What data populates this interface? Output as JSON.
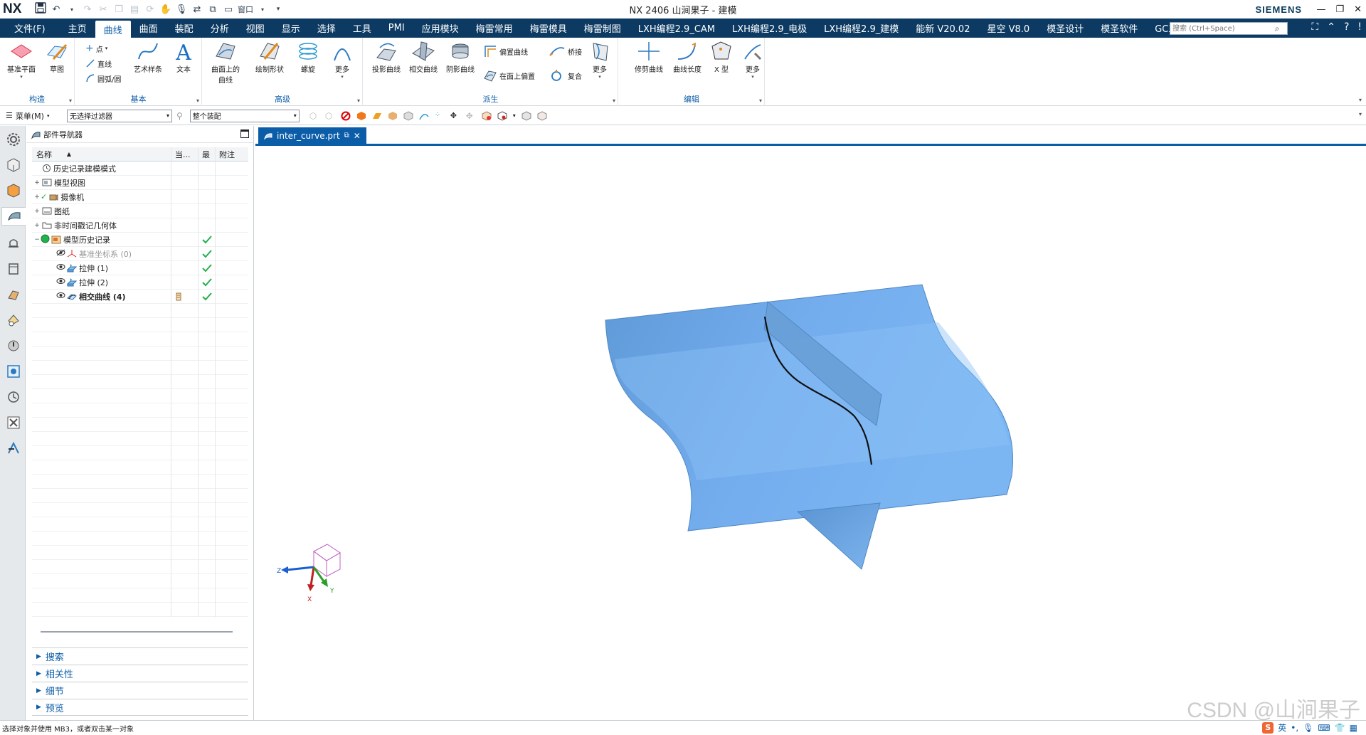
{
  "titlebar": {
    "logo": "NX",
    "window_label": "窗口",
    "title": "NX 2406 山涧果子 - 建模",
    "brand": "SIEMENS",
    "controls": [
      "—",
      "❐",
      "✕"
    ]
  },
  "menu": {
    "tabs": [
      "文件(F)",
      "主页",
      "曲线",
      "曲面",
      "装配",
      "分析",
      "视图",
      "显示",
      "选择",
      "工具",
      "PMI",
      "应用模块",
      "梅雷常用",
      "梅雷模具",
      "梅雷制图",
      "LXH编程2.9_CAM",
      "LXH编程2.9_电极",
      "LXH编程2.9_建模",
      "能新 V20.02",
      "星空 V8.0",
      "模圣设计",
      "模圣软件",
      "GC工具箱"
    ],
    "active_tab": "曲线",
    "search_placeholder": "搜索 (Ctrl+Space)"
  },
  "ribbon": {
    "groups": [
      {
        "label": "构造"
      },
      {
        "label": "基本"
      },
      {
        "label": "高级"
      },
      {
        "label": "派生"
      },
      {
        "label": "编辑"
      }
    ],
    "buttons": {
      "datum_plane": "基准平面",
      "sketch": "草图",
      "point": "点",
      "line": "直线",
      "arc": "圆弧/圆",
      "studio_spline": "艺术样条",
      "text": "文本",
      "curve_on_surface": "曲面上的曲线",
      "law_curve": "绘制形状",
      "helix": "螺旋",
      "more_adv": "更多",
      "project_curve": "投影曲线",
      "intersect_curve": "相交曲线",
      "shadow_curve": "阴影曲线",
      "offset_curve": "偏置曲线",
      "offset_in_face": "在面上偏置",
      "bridge": "桥接",
      "composite": "复合",
      "more_derived": "更多",
      "trim_curve": "修剪曲线",
      "curve_length": "曲线长度",
      "x_form": "X 型",
      "more_edit": "更多"
    }
  },
  "selbar": {
    "menu_label": "菜单(M)",
    "filter_value": "无选择过滤器",
    "scope_value": "整个装配"
  },
  "navigator": {
    "title": "部件导航器",
    "columns": [
      "名称",
      "当...",
      "最",
      "附注"
    ],
    "rows": [
      {
        "label": "历史记录建模模式",
        "expander": "",
        "indent": 0,
        "check": false,
        "style": "normal",
        "icon": "clock-icon",
        "flag": false
      },
      {
        "label": "模型视图",
        "expander": "+",
        "indent": 0,
        "check": false,
        "style": "normal",
        "icon": "model-view-icon",
        "flag": false
      },
      {
        "label": "摄像机",
        "expander": "+",
        "indent": 0,
        "check": false,
        "style": "normal",
        "icon": "camera-icon",
        "flag": false
      },
      {
        "label": "图纸",
        "expander": "+",
        "indent": 0,
        "check": false,
        "style": "normal",
        "icon": "drawing-icon",
        "flag": false
      },
      {
        "label": "非时间戳记几何体",
        "expander": "+",
        "indent": 0,
        "check": false,
        "style": "normal",
        "icon": "folder-icon",
        "flag": false
      },
      {
        "label": "模型历史记录",
        "expander": "−",
        "indent": 0,
        "check": true,
        "style": "normal",
        "icon": "history-folder-icon",
        "flag": false
      },
      {
        "label": "基准坐标系 (0)",
        "expander": "",
        "indent": 1,
        "check": true,
        "style": "dim",
        "icon": "datum-csys-icon",
        "flag": false
      },
      {
        "label": "拉伸 (1)",
        "expander": "",
        "indent": 1,
        "check": true,
        "style": "normal",
        "icon": "extrude-icon",
        "flag": false
      },
      {
        "label": "拉伸 (2)",
        "expander": "",
        "indent": 1,
        "check": true,
        "style": "normal",
        "icon": "extrude-icon",
        "flag": false
      },
      {
        "label": "相交曲线 (4)",
        "expander": "",
        "indent": 1,
        "check": true,
        "style": "bold",
        "icon": "intersect-curve-icon",
        "flag": true
      }
    ],
    "panes": [
      "搜索",
      "相关性",
      "细节",
      "预览"
    ]
  },
  "document": {
    "tab_label": "inter_curve.prt"
  },
  "triad": {
    "x": "X",
    "y": "Y",
    "z": "Z"
  },
  "status": {
    "message": "选择对象并使用 MB3，或者双击某一对象",
    "watermark": "CSDN @山涧果子",
    "ime_label": "英"
  },
  "colors": {
    "brand_dark": "#0c3a62",
    "accent_blue": "#0c5da8",
    "surface_blue": "#6ba6e0",
    "check_green": "#22b14c"
  }
}
